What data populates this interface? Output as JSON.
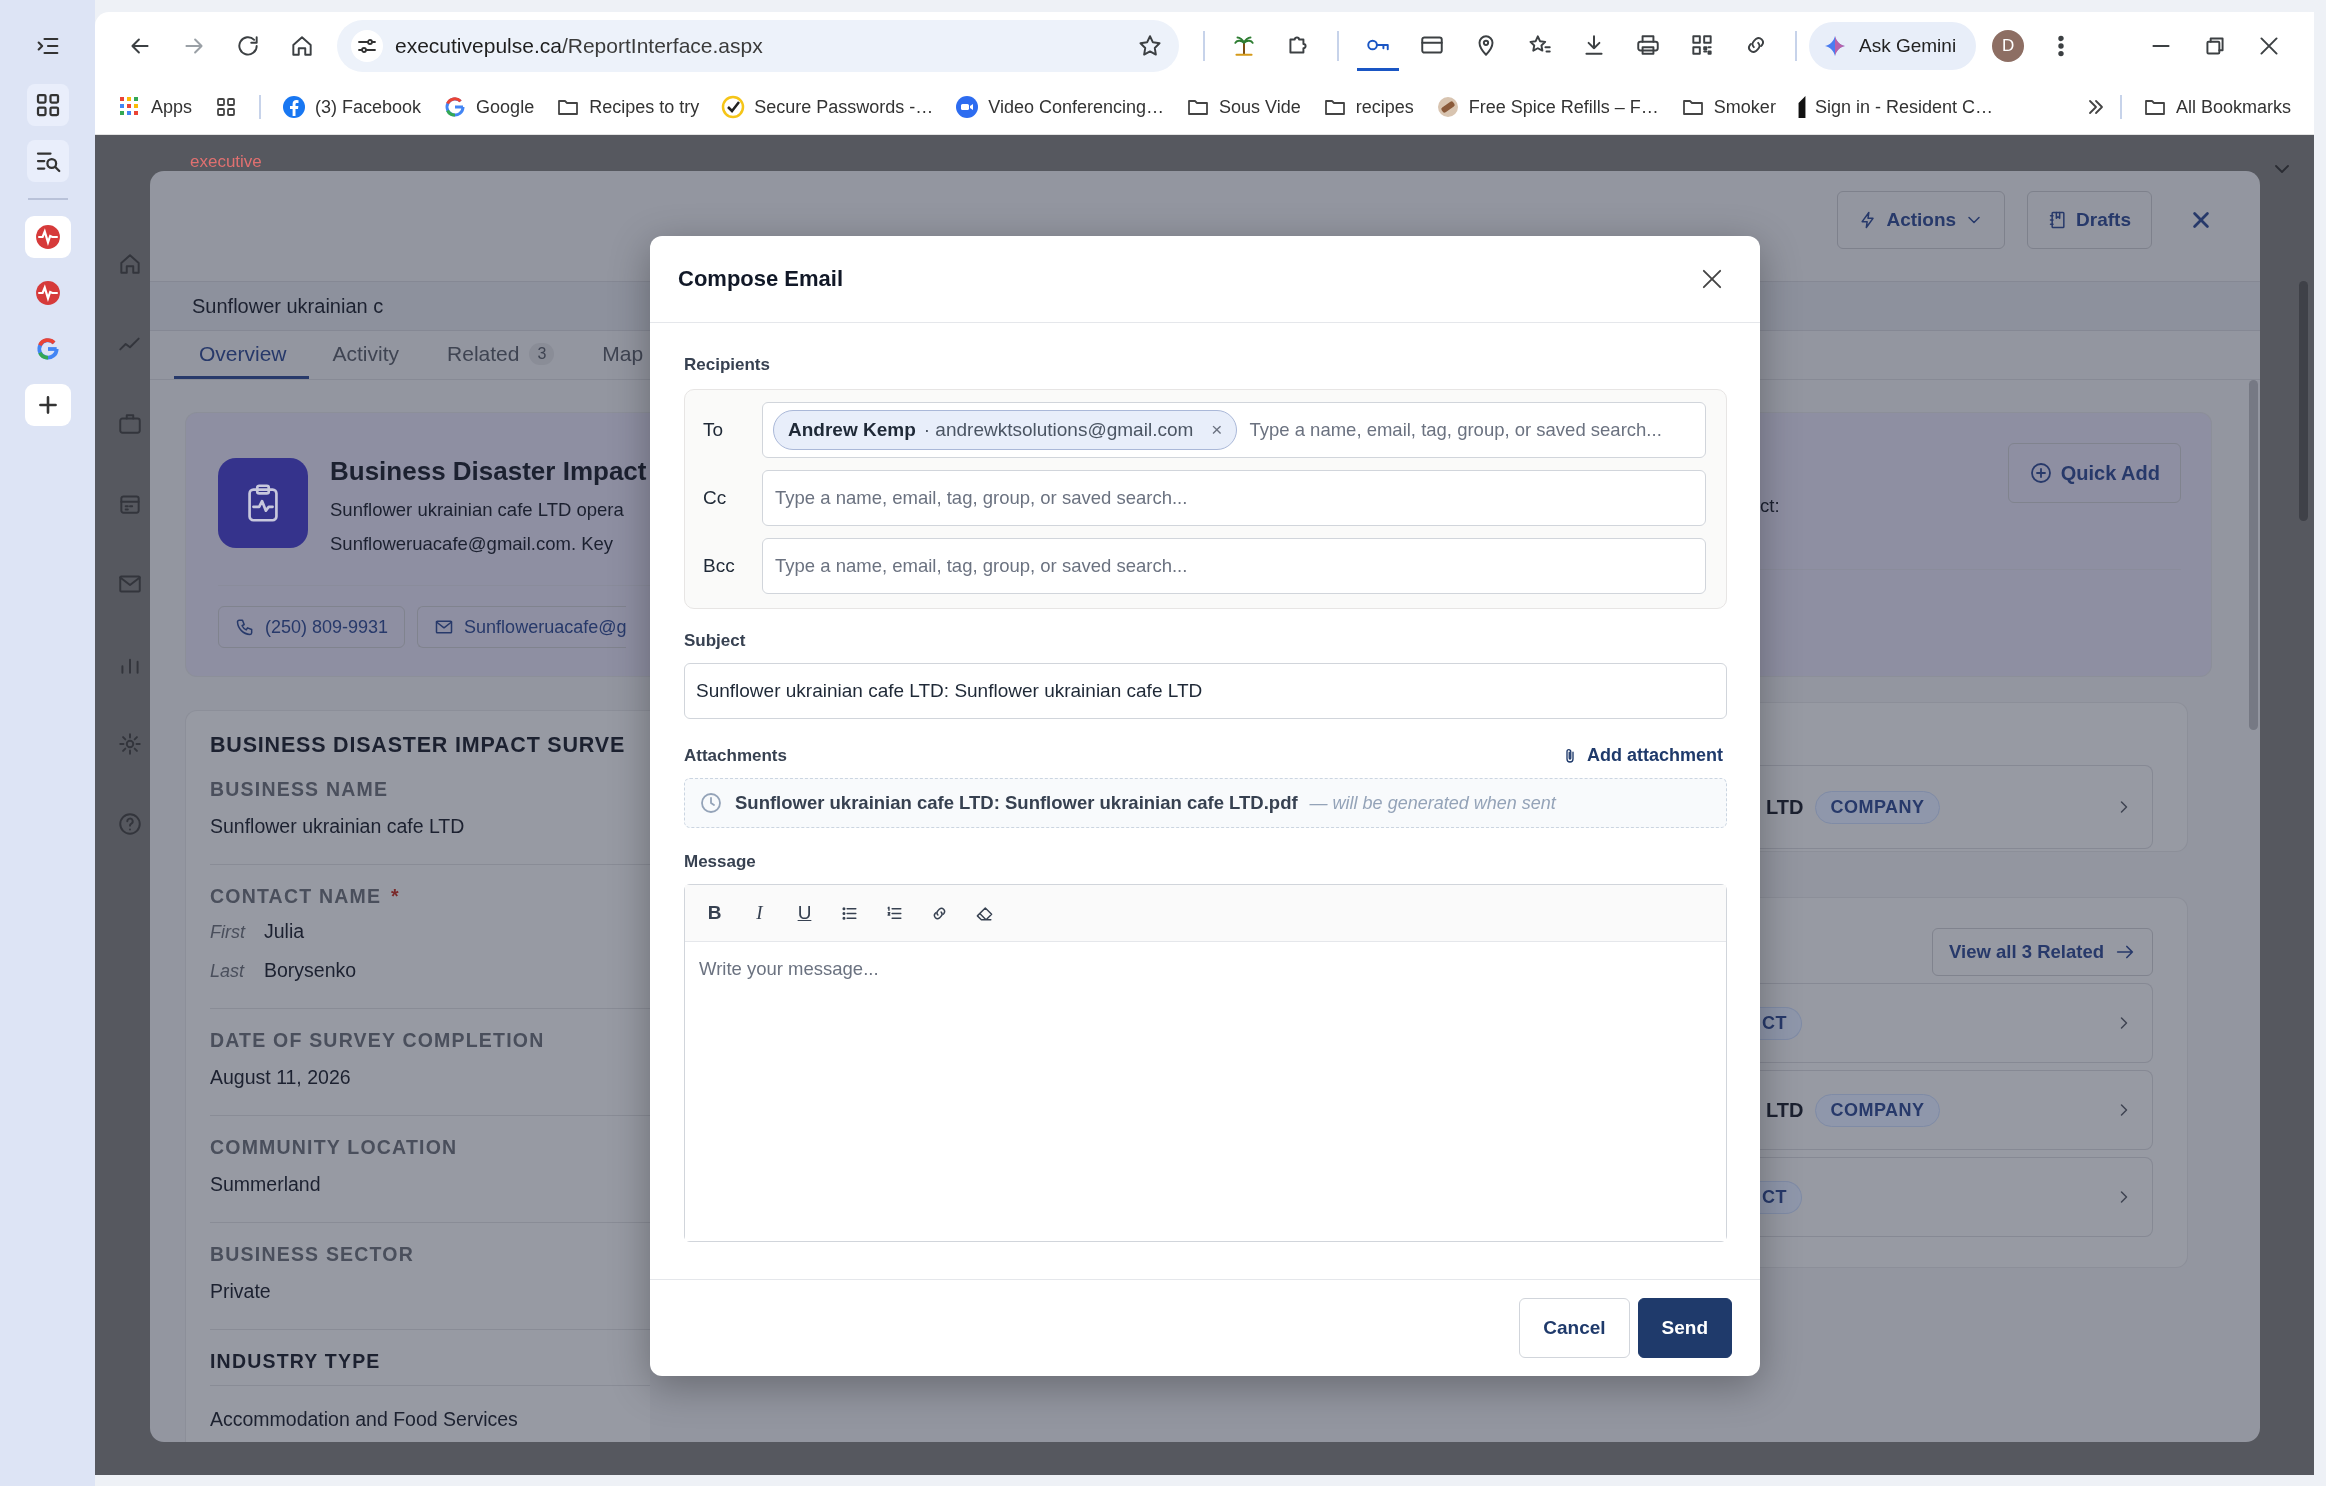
{
  "browser": {
    "vertical_tabs": [
      {
        "kind": "pulse",
        "selected": true
      },
      {
        "kind": "pulse",
        "selected": false
      },
      {
        "kind": "google",
        "selected": false
      }
    ],
    "url_domain": "executivepulse.ca",
    "url_path": "/ReportInterface.aspx",
    "toolbar_icons": [
      {
        "kind": "palm",
        "active": false
      },
      {
        "kind": "puzzle",
        "active": false
      },
      {
        "kind": "key",
        "active": true
      },
      {
        "kind": "card",
        "active": false
      },
      {
        "kind": "pin",
        "active": false
      },
      {
        "kind": "starlist",
        "active": false
      },
      {
        "kind": "download",
        "active": false
      },
      {
        "kind": "print",
        "active": false
      },
      {
        "kind": "qr",
        "active": false
      },
      {
        "kind": "link",
        "active": false
      }
    ],
    "gemini": "Ask Gemini",
    "profile": "D",
    "bookmarks": [
      {
        "kind": "apps",
        "label": "Apps"
      },
      {
        "kind": "grid"
      },
      {
        "kind": "facebook",
        "label": "(3) Facebook"
      },
      {
        "kind": "google",
        "label": "Google"
      },
      {
        "kind": "folder",
        "label": "Recipes to try"
      },
      {
        "kind": "check",
        "label": "Secure Passwords -…"
      },
      {
        "kind": "zoom",
        "label": "Video Conferencing…"
      },
      {
        "kind": "folder",
        "label": "Sous Vide"
      },
      {
        "kind": "folder",
        "label": "recipes"
      },
      {
        "kind": "spice",
        "label": "Free Spice Refills – F…"
      },
      {
        "kind": "folder",
        "label": "Smoker"
      },
      {
        "kind": "resident",
        "label": "Sign in - Resident C…"
      }
    ],
    "all_bookmarks": "All Bookmarks"
  },
  "page": {
    "logo": "executive"
  },
  "drawer": {
    "title": "Sunflower ukrainian c",
    "actions": [
      {
        "kind": "actions",
        "label": "Actions"
      },
      {
        "kind": "drafts",
        "label": "Drafts"
      }
    ],
    "tabs": [
      {
        "label": "Overview",
        "selected": true
      },
      {
        "label": "Activity",
        "selected": false
      },
      {
        "label": "Related",
        "count": "3",
        "selected": false
      },
      {
        "label": "Map",
        "selected": false
      }
    ],
    "summary": {
      "title": "Business Disaster Impact",
      "lines": [
        "Sunflower ukrainian cafe LTD opera",
        "Sunfloweruacafe@gmail.com. Key"
      ],
      "contacts": [
        {
          "kind": "phone",
          "label": "(250) 809-9931"
        },
        {
          "kind": "email",
          "label": "Sunfloweruacafe@g"
        }
      ],
      "tail": "ct:",
      "quick_add": "Quick Add"
    },
    "survey": {
      "heading": "BUSINESS DISASTER IMPACT SURVE",
      "fields": [
        {
          "kind": "field",
          "label": "BUSINESS NAME",
          "value": "Sunflower ukrainian cafe LTD"
        },
        {
          "kind": "name",
          "label": "CONTACT NAME",
          "required_mark": "*",
          "parts": [
            {
              "label": "First",
              "value": "Julia"
            },
            {
              "label": "Last",
              "value": "Borysenko"
            }
          ]
        },
        {
          "kind": "field",
          "label": "DATE OF SURVEY COMPLETION",
          "value": "August 11, 2026"
        },
        {
          "kind": "field",
          "label": "COMMUNITY LOCATION",
          "value": "Summerland"
        },
        {
          "kind": "field",
          "label": "BUSINESS SECTOR",
          "value": "Private"
        },
        {
          "kind": "section",
          "label": "INDUSTRY TYPE",
          "value": "Accommodation and Food Services"
        }
      ]
    },
    "company": {
      "rows": [
        {
          "text": "LTD",
          "tag": "COMPANY"
        }
      ]
    },
    "related": {
      "button": "View all 3 Related",
      "rows": [
        {
          "tag": "CT"
        },
        {
          "text": "LTD",
          "tag": "COMPANY"
        },
        {
          "tag": "CT"
        }
      ]
    }
  },
  "modal": {
    "title": "Compose Email",
    "recipients_label": "Recipients",
    "rows": [
      {
        "label": "To",
        "chips": [
          {
            "name": "Andrew Kemp",
            "email": "· andrewktsolutions@gmail.com",
            "remove": "×"
          }
        ],
        "placeholder": "Type a name, email, tag, group, or saved search..."
      },
      {
        "label": "Cc",
        "placeholder": "Type a name, email, tag, group, or saved search..."
      },
      {
        "label": "Bcc",
        "placeholder": "Type a name, email, tag, group, or saved search..."
      }
    ],
    "subject_label": "Subject",
    "subject": "Sunflower ukrainian cafe LTD: Sunflower ukrainian cafe LTD",
    "attachments_label": "Attachments",
    "add_attachment": "Add attachment",
    "attachments": [
      {
        "name": "Sunflower ukrainian cafe LTD: Sunflower ukrainian cafe LTD.pdf",
        "note": "— will be generated when sent"
      }
    ],
    "message_label": "Message",
    "message_placeholder": "Write your message...",
    "toolbar": [
      {
        "kind": "bold",
        "label": "B"
      },
      {
        "kind": "italic",
        "label": "I"
      },
      {
        "kind": "underline",
        "label": "U"
      },
      {
        "kind": "bullets"
      },
      {
        "kind": "numbers"
      },
      {
        "kind": "link"
      },
      {
        "kind": "eraser"
      }
    ],
    "buttons": [
      {
        "kind": "secondary",
        "label": "Cancel"
      },
      {
        "kind": "primary",
        "label": "Send"
      }
    ]
  }
}
